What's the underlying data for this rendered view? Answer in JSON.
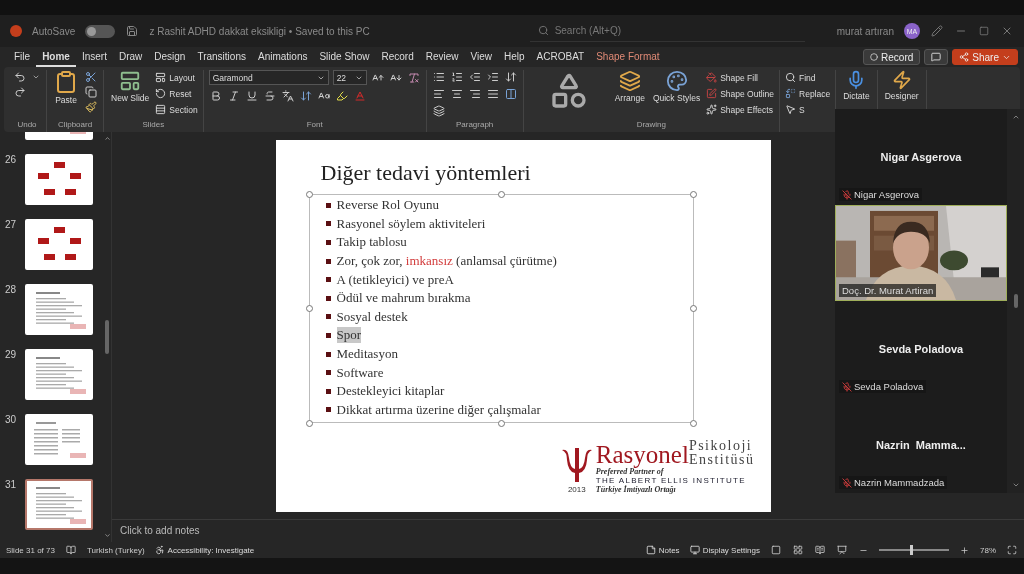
{
  "title_bar": {
    "autosave_label": "AutoSave",
    "autosave_on": false,
    "file_name": "z Rashit ADHD dakkat eksikligi • Saved to this PC",
    "search_placeholder": "Search (Alt+Q)",
    "user_name": "murat artıran",
    "user_initials": "MA"
  },
  "menu_tabs": [
    {
      "label": "File",
      "selected": false,
      "kind": "plain"
    },
    {
      "label": "Home",
      "selected": true,
      "kind": "plain"
    },
    {
      "label": "Insert",
      "selected": false,
      "kind": "plain"
    },
    {
      "label": "Draw",
      "selected": false,
      "kind": "plain"
    },
    {
      "label": "Design",
      "selected": false,
      "kind": "plain"
    },
    {
      "label": "Transitions",
      "selected": false,
      "kind": "plain"
    },
    {
      "label": "Animations",
      "selected": false,
      "kind": "plain"
    },
    {
      "label": "Slide Show",
      "selected": false,
      "kind": "plain"
    },
    {
      "label": "Record",
      "selected": false,
      "kind": "plain"
    },
    {
      "label": "Review",
      "selected": false,
      "kind": "plain"
    },
    {
      "label": "View",
      "selected": false,
      "kind": "plain"
    },
    {
      "label": "Help",
      "selected": false,
      "kind": "plain"
    },
    {
      "label": "ACROBAT",
      "selected": false,
      "kind": "plain"
    },
    {
      "label": "Shape Format",
      "selected": false,
      "kind": "contextual"
    }
  ],
  "menu_buttons": {
    "record": "Record",
    "share": "Share"
  },
  "ribbon_groups": [
    {
      "kind": "undo",
      "label": "Undo"
    },
    {
      "kind": "clipboard",
      "label": "Clipboard",
      "paste": "Paste"
    },
    {
      "kind": "slides",
      "label": "Slides",
      "new_slide": "New Slide",
      "buttons": [
        "Layout",
        "Reset",
        "Section"
      ]
    },
    {
      "kind": "font",
      "label": "Font",
      "font": "Garamond",
      "size": "22"
    },
    {
      "kind": "paragraph",
      "label": "Paragraph"
    },
    {
      "kind": "drawing",
      "label": "Drawing",
      "arrange": "Arrange",
      "quick_styles": "Quick Styles",
      "buttons": [
        "Shape Fill",
        "Shape Outline",
        "Shape Effects"
      ]
    },
    {
      "kind": "editing",
      "buttons": [
        "Find",
        "Replace",
        "S"
      ]
    },
    {
      "kind": "voice",
      "label": "Dictate"
    },
    {
      "kind": "designer",
      "label": "Designer"
    }
  ],
  "slides_panel": [
    {
      "kind": "text",
      "selected": false
    },
    {
      "number": "26",
      "kind": "cycle",
      "selected": false
    },
    {
      "number": "27",
      "kind": "cycle",
      "selected": false
    },
    {
      "number": "28",
      "kind": "text",
      "selected": false
    },
    {
      "number": "29",
      "kind": "text",
      "selected": false
    },
    {
      "number": "30",
      "kind": "columns",
      "selected": false
    },
    {
      "number": "31",
      "kind": "text",
      "selected": true
    }
  ],
  "slide": {
    "title": "Diğer tedavi yöntemleri",
    "bullets": [
      {
        "segments": [
          {
            "text": "Reverse Rol Oyunu",
            "kind": "plain"
          }
        ],
        "selected": false
      },
      {
        "segments": [
          {
            "text": "Rasyonel söylem aktiviteleri",
            "kind": "plain"
          }
        ],
        "selected": false
      },
      {
        "segments": [
          {
            "text": "Takip tablosu",
            "kind": "plain"
          }
        ],
        "selected": false
      },
      {
        "segments": [
          {
            "text": "Zor, çok zor,",
            "kind": "plain"
          },
          {
            "text": "imkansız",
            "kind": "accent"
          },
          {
            "text": "(anlamsal çürütme)",
            "kind": "plain"
          }
        ],
        "selected": false
      },
      {
        "segments": [
          {
            "text": "A (tetikleyici) ve preA",
            "kind": "plain"
          }
        ],
        "selected": false
      },
      {
        "segments": [
          {
            "text": "Ödül ve mahrum bırakma",
            "kind": "plain"
          }
        ],
        "selected": false
      },
      {
        "segments": [
          {
            "text": "Sosyal destek",
            "kind": "plain"
          }
        ],
        "selected": false
      },
      {
        "segments": [
          {
            "text": "Spor",
            "kind": "plain"
          }
        ],
        "selected": true
      },
      {
        "segments": [
          {
            "text": "Meditasyon",
            "kind": "plain"
          }
        ],
        "selected": false
      },
      {
        "segments": [
          {
            "text": "Software",
            "kind": "plain"
          }
        ],
        "selected": false
      },
      {
        "segments": [
          {
            "text": "Destekleyici kitaplar",
            "kind": "plain"
          }
        ],
        "selected": false
      },
      {
        "segments": [
          {
            "text": "Dikkat artırma üzerine diğer çalışmalar",
            "kind": "plain"
          }
        ],
        "selected": false
      }
    ],
    "logo": {
      "name": "Rasyonel",
      "line_1": "Psikoloji",
      "line_2": "Enstitüsü",
      "year": "2013",
      "partner_note": "Preferred Partner of",
      "institute": "THE ALBERT ELLIS INSTITUTE",
      "partner_role": "Türkiye İmtiyazlı Ortağı"
    }
  },
  "notes": {
    "placeholder": "Click to add notes"
  },
  "status_bar": {
    "slide_count": "Slide 31 of 73",
    "language": "Turkish (Turkey)",
    "accessibility": "Accessibility: Investigate",
    "notes": "Notes",
    "display_settings": "Display Settings",
    "zoom": "78%",
    "zoom_slider": {
      "level": 0.45
    }
  },
  "meeting_panel": {
    "participants": [
      {
        "kind": "name",
        "title": "Nigar Asgerova",
        "label": "Nigar Asgerova",
        "muted": true,
        "speaking": false
      },
      {
        "kind": "video",
        "label": "Doç. Dr. Murat Artiran",
        "muted": false,
        "speaking": true
      },
      {
        "kind": "name",
        "title": "Sevda Poladova",
        "label": "Sevda Poladova",
        "muted": true,
        "speaking": false
      },
      {
        "kind": "name",
        "title": "Nazrin  Mamma...",
        "label": "Nazrin Mammadzada",
        "muted": true,
        "speaking": false
      }
    ]
  }
}
